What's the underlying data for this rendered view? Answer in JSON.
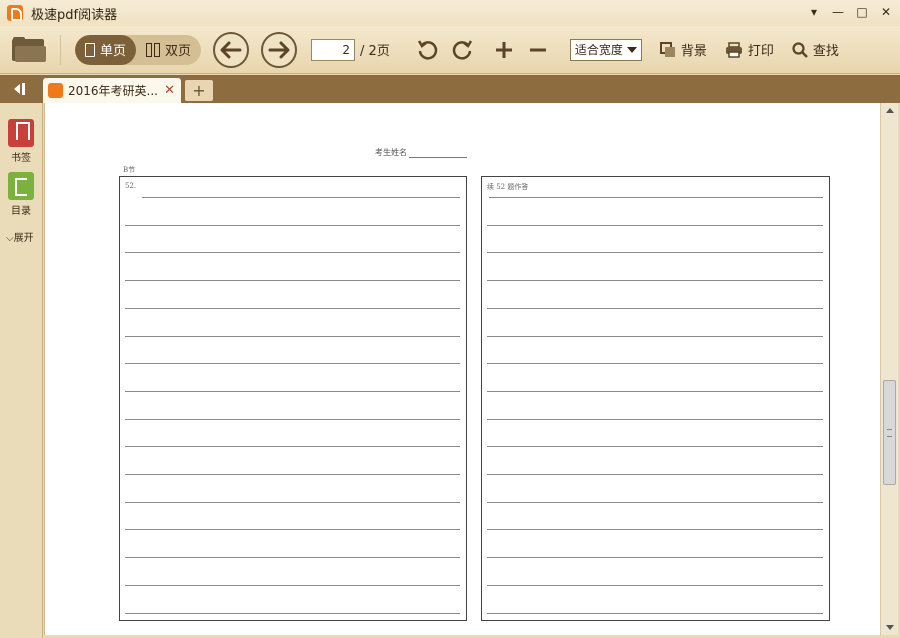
{
  "window": {
    "title": "极速pdf阅读器",
    "controls": {
      "menu": "▾",
      "minimize": "—",
      "maximize": "□",
      "close": "✕"
    }
  },
  "toolbar": {
    "view_single": "单页",
    "view_double": "双页",
    "current_page": "2",
    "total_pages": "/ 2页",
    "zoom_value": "适合宽度",
    "background_label": "背景",
    "print_label": "打印",
    "find_label": "查找"
  },
  "tabs": [
    {
      "label": "2016年考研英..."
    }
  ],
  "add_tab_label": "+",
  "sidebar": {
    "bookmarks_label": "书签",
    "toc_label": "目录",
    "expand_label": "展开"
  },
  "document": {
    "candidate_name_label": "考生姓名",
    "section_label": "B节",
    "left_box_label": "52.",
    "right_box_label": "续 52 题作答"
  },
  "colors": {
    "titlebar": "#f2e6cb",
    "toolbar": "#ecdcb8",
    "tabstrip": "#8d6c3f",
    "accent": "#7b6039",
    "logo": "#f07a1a"
  }
}
